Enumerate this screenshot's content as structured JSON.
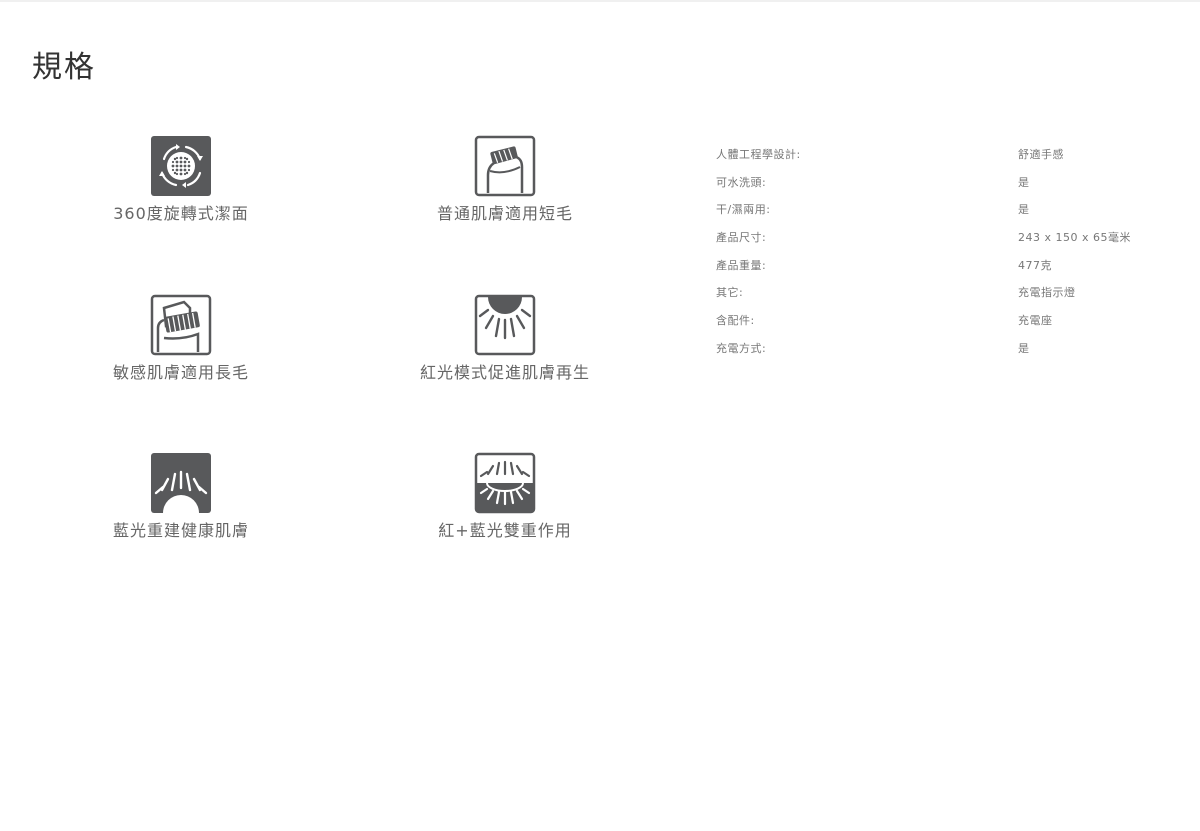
{
  "page_title": "規格",
  "colors": {
    "icon_dark": "#58595b",
    "icon_outline": "#58595b",
    "text": "#666666",
    "title": "#333333"
  },
  "features": [
    {
      "label": "360度旋轉式潔面",
      "icon": "rotation-icon"
    },
    {
      "label": "普通肌膚適用短毛",
      "icon": "short-bristle-brush-icon"
    },
    {
      "label": "敏感肌膚適用長毛",
      "icon": "long-bristle-brush-icon"
    },
    {
      "label": "紅光模式促進肌膚再生",
      "icon": "red-light-icon"
    },
    {
      "label": "藍光重建健康肌膚",
      "icon": "blue-light-icon"
    },
    {
      "label": "紅+藍光雙重作用",
      "icon": "dual-light-icon"
    }
  ],
  "specs": [
    {
      "key": "人體工程學設計:",
      "value": "舒適手感"
    },
    {
      "key": "可水洗頭:",
      "value": "是"
    },
    {
      "key": "干/濕兩用:",
      "value": "是"
    },
    {
      "key": "產品尺寸:",
      "value": "243 x 150 x 65毫米"
    },
    {
      "key": "產品重量:",
      "value": "477克"
    },
    {
      "key": "其它:",
      "value": "充電指示燈"
    },
    {
      "key": "含配件:",
      "value": "充電座"
    },
    {
      "key": "充電方式:",
      "value": "是"
    }
  ]
}
